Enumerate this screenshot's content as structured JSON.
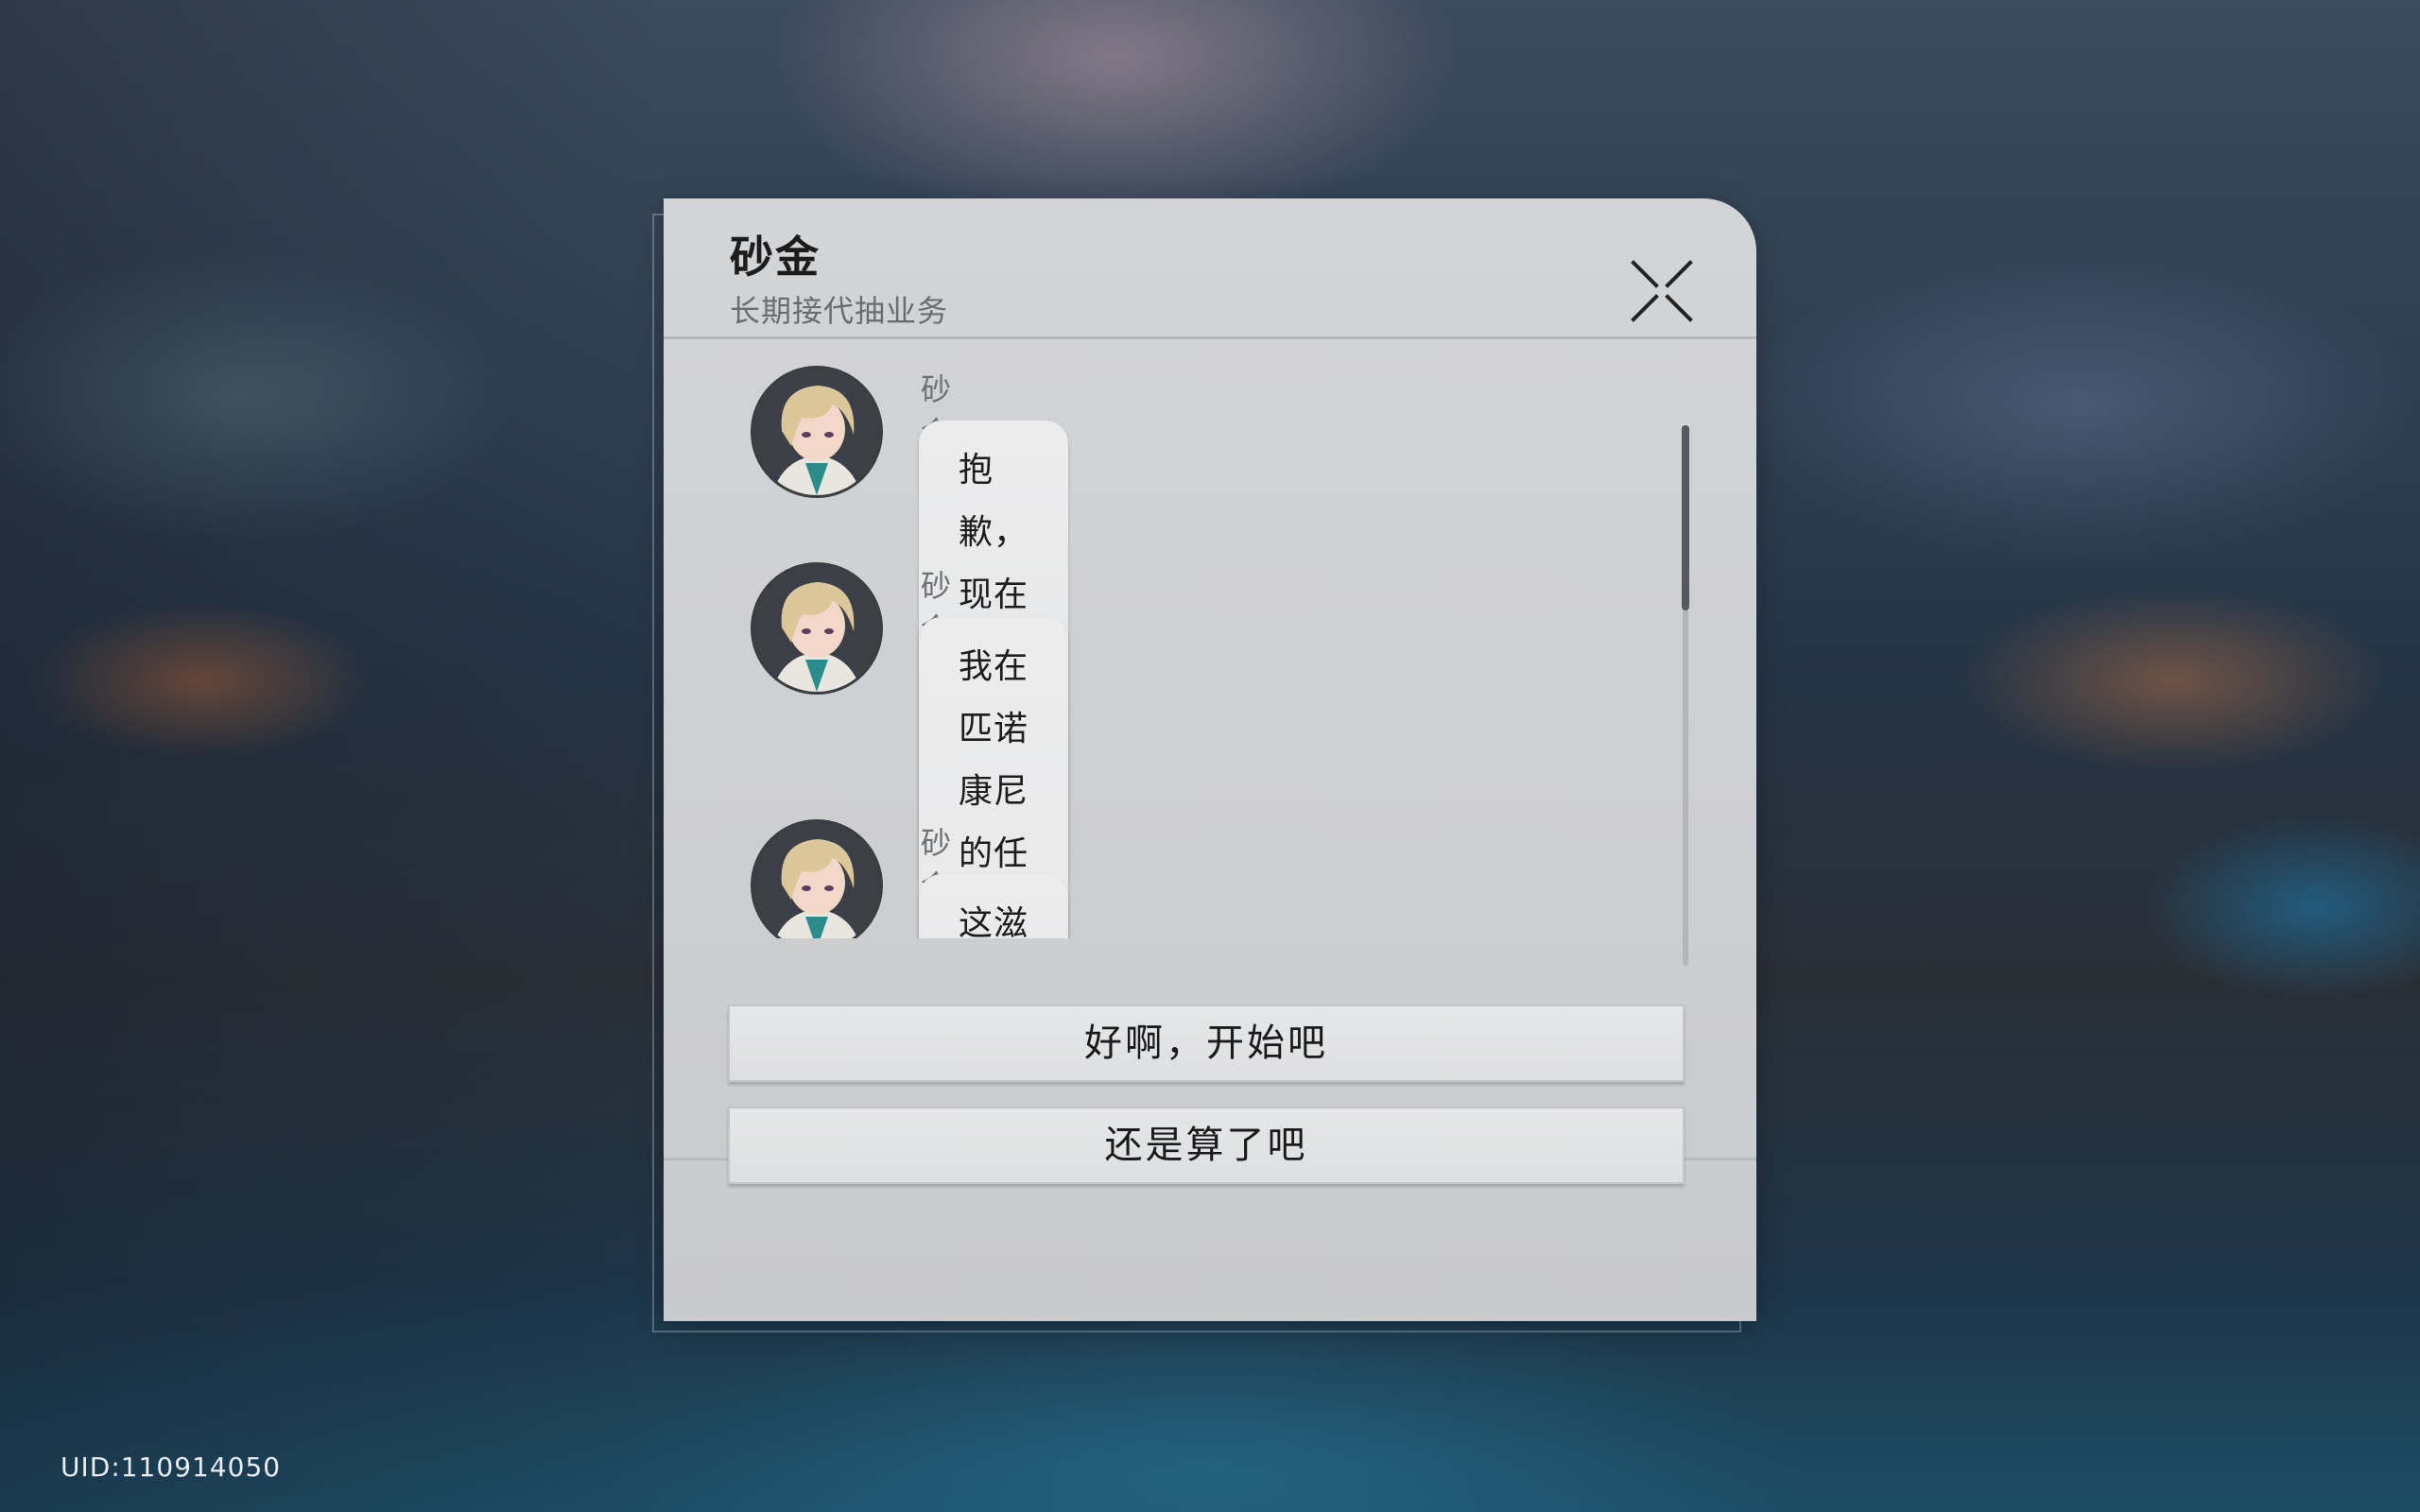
{
  "dialog": {
    "title": "砂金",
    "subtitle": "长期接代抽业务",
    "close_icon": "close-x-icon"
  },
  "messages": [
    {
      "sender": "砂金",
      "text": "抱歉，现在才看到你的消息"
    },
    {
      "sender": "砂金",
      "text": "我在匹诺康尼的任务结束了，现在\n开始才能正大光明地用手机"
    },
    {
      "sender": "砂金",
      "text": "这滋味，堪比坐牢"
    }
  ],
  "choices": [
    {
      "label": "好啊，开始吧"
    },
    {
      "label": "还是算了吧"
    }
  ],
  "footer": {
    "uid": "UID:110914050"
  },
  "colors": {
    "panel": "#cfd0d2",
    "bubble": "#e8e8e9",
    "text": "#1d1d1d",
    "sender": "#6f7072"
  }
}
